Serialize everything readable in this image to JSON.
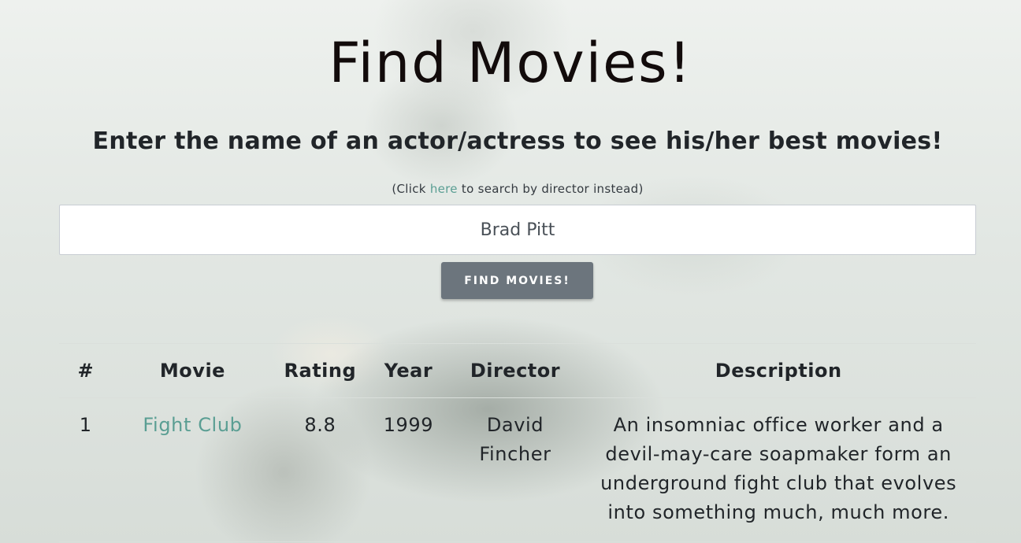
{
  "page": {
    "title": "Find Movies!",
    "subtitle": "Enter the name of an actor/actress to see his/her best movies!",
    "hint_prefix": "(Click ",
    "hint_link": "here",
    "hint_suffix": " to search by director instead)"
  },
  "search": {
    "value": "Brad Pitt",
    "button_label": "FIND MOVIES!"
  },
  "table": {
    "columns": [
      "#",
      "Movie",
      "Rating",
      "Year",
      "Director",
      "Description"
    ],
    "rows": [
      {
        "num": "1",
        "movie": "Fight Club",
        "rating": "8.8",
        "year": "1999",
        "director": "David Fincher",
        "description": "An insomniac office worker and a devil-may-care soapmaker form an underground fight club that evolves into something much, much more."
      }
    ]
  },
  "colors": {
    "link": "#5a9e93",
    "button": "#6c757d"
  }
}
